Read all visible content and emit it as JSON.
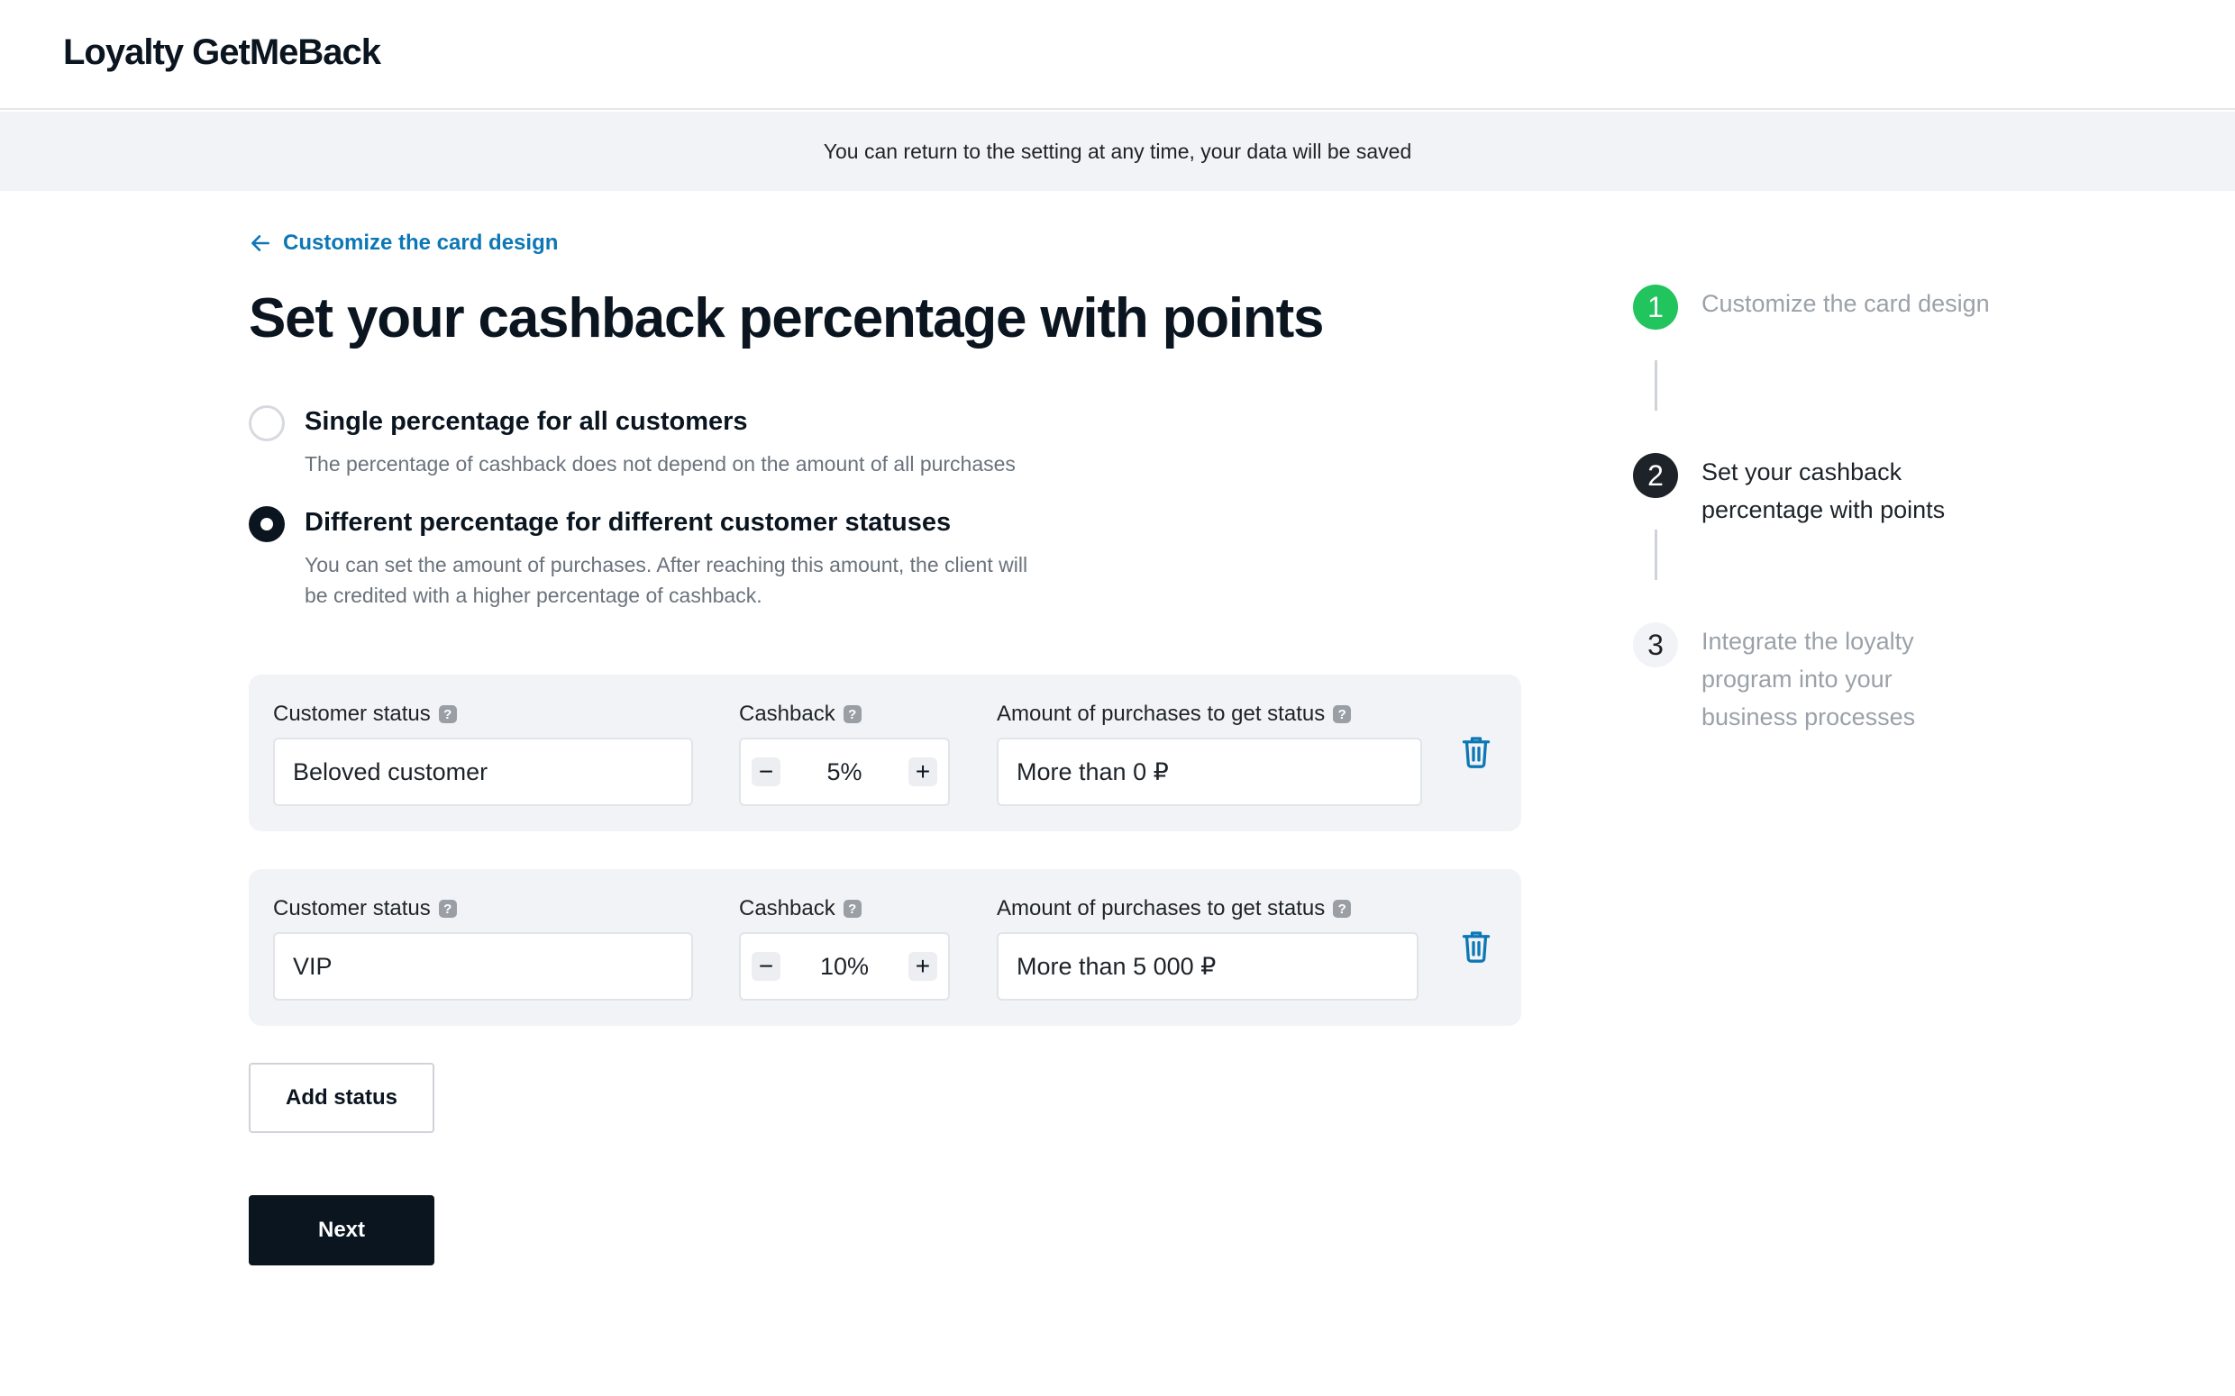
{
  "app": {
    "title": "Loyalty GetMeBack"
  },
  "banner": {
    "text": "You can return to the setting at any time, your data will be saved"
  },
  "nav": {
    "back_label": "Customize the card design"
  },
  "page": {
    "title": "Set your cashback percentage with points"
  },
  "options": [
    {
      "title": "Single percentage for all customers",
      "description": "The percentage of cashback does not depend on the amount of all purchases",
      "selected": false
    },
    {
      "title": "Different percentage for different customer statuses",
      "description": "You can set the amount of purchases. After reaching this amount, the client will be credited with a higher percentage of cashback.",
      "selected": true
    }
  ],
  "labels": {
    "customer_status": "Customer status",
    "cashback": "Cashback",
    "amount": "Amount of purchases to get status",
    "help": "?",
    "minus": "−",
    "plus": "+"
  },
  "statuses": [
    {
      "name": "Beloved customer",
      "cashback": "5%",
      "amount": "More than 0 ₽"
    },
    {
      "name": "VIP",
      "cashback": "10%",
      "amount": "More than 5 000 ₽"
    }
  ],
  "buttons": {
    "add_status": "Add status",
    "next": "Next"
  },
  "steps": [
    {
      "number": "1",
      "label": "Customize the card design",
      "state": "done"
    },
    {
      "number": "2",
      "label": "Set your cashback percentage with points",
      "state": "current"
    },
    {
      "number": "3",
      "label": "Integrate the loyalty program into your business processes",
      "state": "todo"
    }
  ],
  "colors": {
    "accent": "#0d77b5",
    "success": "#21c45d",
    "dark": "#0b1520",
    "muted": "#9ba1a8"
  }
}
